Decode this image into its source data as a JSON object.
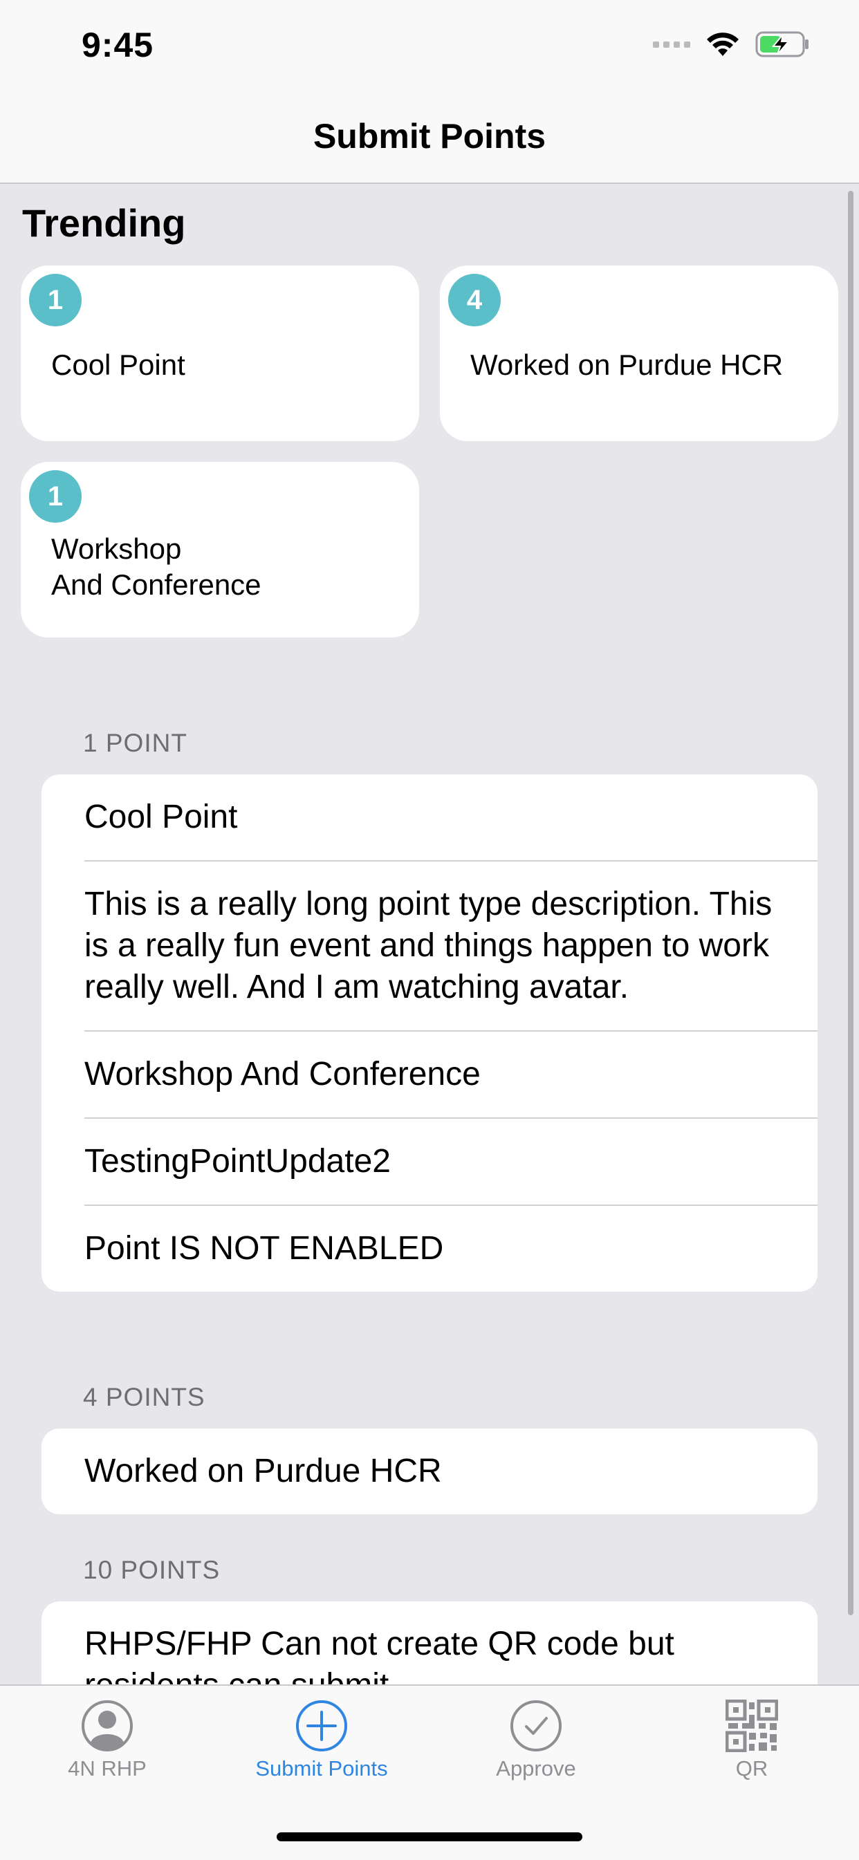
{
  "status_bar": {
    "time": "9:45"
  },
  "nav": {
    "title": "Submit Points"
  },
  "trending": {
    "heading": "Trending",
    "cards": [
      {
        "count": "1",
        "label": "Cool Point"
      },
      {
        "count": "4",
        "label": "Worked on Purdue HCR"
      },
      {
        "count": "1",
        "label_line1": "Workshop",
        "label_line2": "And Conference"
      }
    ]
  },
  "sections": [
    {
      "header": "1 POINT",
      "rows": [
        "Cool Point",
        "This is a really long point type description. This is a really fun event and things happen to work really well. And I am watching avatar.",
        "Workshop And Conference",
        "TestingPointUpdate2",
        "Point IS NOT ENABLED"
      ]
    },
    {
      "header": "4 POINTS",
      "rows": [
        "Worked on Purdue HCR"
      ]
    },
    {
      "header": "10 POINTS",
      "rows": [
        "RHPS/FHP Can not create QR code but residents can submit"
      ]
    }
  ],
  "tabs": [
    {
      "label": "4N RHP",
      "icon": "person-circle-icon"
    },
    {
      "label": "Submit Points",
      "icon": "plus-circle-icon"
    },
    {
      "label": "Approve",
      "icon": "checkmark-circle-icon"
    },
    {
      "label": "QR",
      "icon": "qrcode-icon"
    }
  ],
  "colors": {
    "accent": "#2f86e0",
    "badge": "#5bbfc9",
    "inactive_tab": "#8e8e93"
  }
}
